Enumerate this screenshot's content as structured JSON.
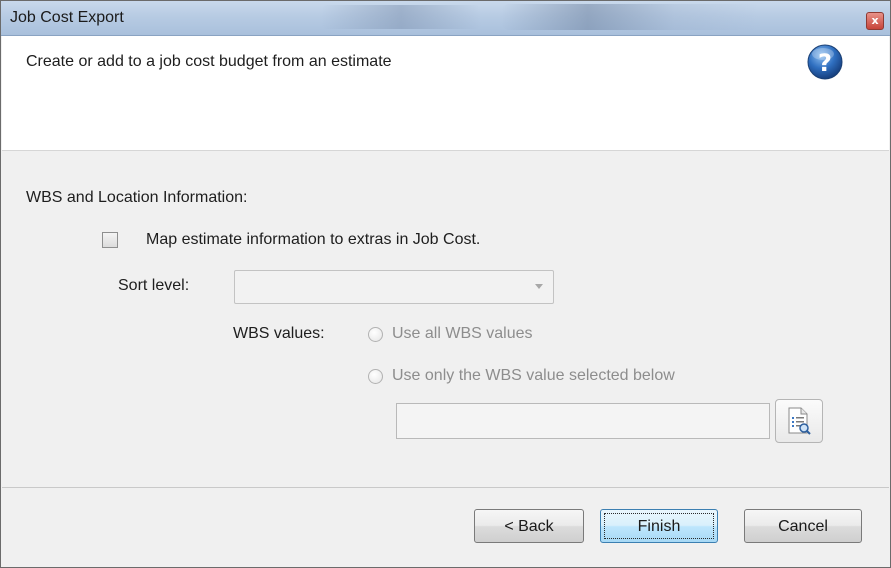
{
  "window": {
    "title": "Job Cost Export",
    "close_glyph": "x"
  },
  "header": {
    "description": "Create or add to a job cost budget from an estimate",
    "help_icon": "help-question-icon"
  },
  "wbs_section": {
    "heading": "WBS and Location Information:",
    "map_checkbox": {
      "label": "Map estimate information to extras in Job Cost.",
      "checked": false
    },
    "sort_level": {
      "label": "Sort level:",
      "value": ""
    },
    "wbs_values": {
      "label": "WBS values:",
      "options": [
        {
          "label": "Use all WBS values",
          "selected": false,
          "enabled": false
        },
        {
          "label": "Use only the WBS value selected below",
          "selected": false,
          "enabled": false
        }
      ],
      "selected_value": "",
      "browse_icon": "browse-list-icon"
    }
  },
  "footer": {
    "back_label": "< Back",
    "finish_label": "Finish",
    "cancel_label": "Cancel"
  },
  "colors": {
    "titlebar": "#b7cbe3",
    "default_button_border": "#3c7fb1",
    "help_icon": "#1f5fae"
  }
}
